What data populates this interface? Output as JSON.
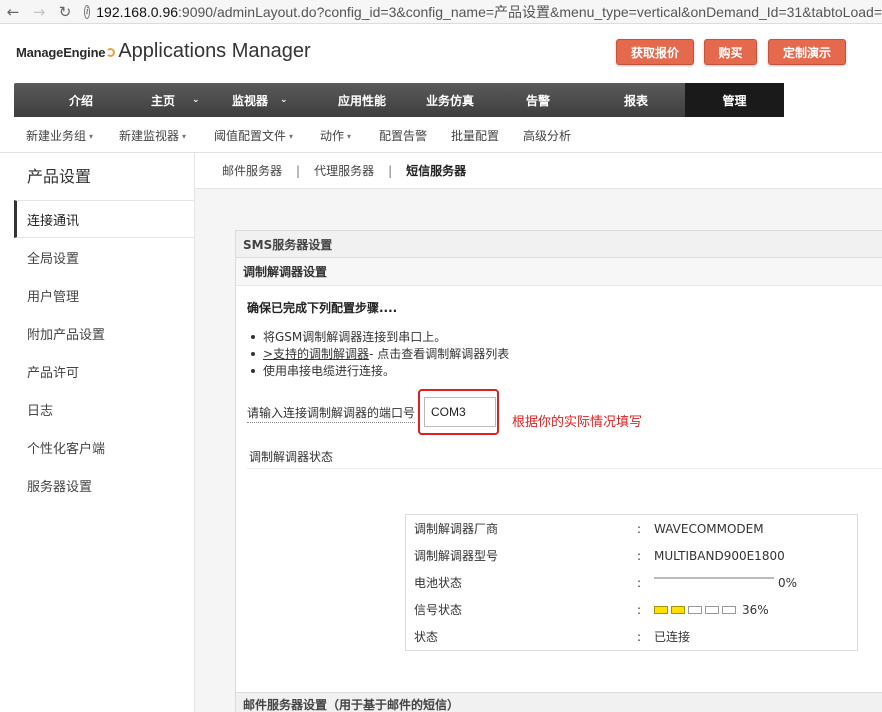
{
  "browser": {
    "back_icon": "arrow-left-icon",
    "forward_icon": "arrow-right-icon",
    "reload_icon": "reload-icon",
    "info_icon": "info-icon",
    "url_host": "192.168.0.96",
    "url_rest": ":9090/adminLayout.do?config_id=3&config_name=产品设置&menu_type=vertical&onDemand_Id=31&tabtoLoad="
  },
  "header": {
    "logo_brand": "ManageEngine",
    "logo_product": "Applications Manager",
    "buttons": [
      "获取报价",
      "购买",
      "定制演示"
    ],
    "accent_color": "#e5694c"
  },
  "mainnav": {
    "items": [
      {
        "label": "介绍",
        "chevron": false
      },
      {
        "label": "主页",
        "chevron": true
      },
      {
        "label": "监视器",
        "chevron": true
      },
      {
        "label": "应用性能",
        "chevron": false
      },
      {
        "label": "业务仿真",
        "chevron": false
      },
      {
        "label": "告警",
        "chevron": false
      },
      {
        "label": "报表",
        "chevron": false
      },
      {
        "label": "管理",
        "chevron": false,
        "active": true
      }
    ]
  },
  "subnav": {
    "items": [
      {
        "label": "新建业务组",
        "caret": true
      },
      {
        "label": "新建监视器",
        "caret": true
      },
      {
        "label": "阈值配置文件",
        "caret": true
      },
      {
        "label": "动作",
        "caret": true
      },
      {
        "label": "配置告警",
        "caret": false
      },
      {
        "label": "批量配置",
        "caret": false
      },
      {
        "label": "高级分析",
        "caret": false
      }
    ]
  },
  "sidebar": {
    "title": "产品设置",
    "items": [
      {
        "label": "连接通讯",
        "active": true
      },
      {
        "label": "全局设置"
      },
      {
        "label": "用户管理"
      },
      {
        "label": "附加产品设置"
      },
      {
        "label": "产品许可"
      },
      {
        "label": "日志"
      },
      {
        "label": "个性化客户端"
      },
      {
        "label": "服务器设置"
      }
    ]
  },
  "tabs": {
    "items": [
      "邮件服务器",
      "代理服务器",
      "短信服务器"
    ],
    "separator": "|",
    "active_index": 2
  },
  "sms": {
    "panel_title": "SMS服务器设置",
    "section_title": "调制解调器设置",
    "steps_title": "确保已完成下列配置步骤....",
    "steps": [
      {
        "text": "将GSM调制解调器连接到串口上。"
      },
      {
        "link": ">支持的调制解调器",
        "text": " - 点击查看调制解调器列表"
      },
      {
        "text": "使用串接电缆进行连接。"
      }
    ],
    "port_label": "请输入连接调制解调器的端口号",
    "port_value": "COM3",
    "annotation": "根据你的实际情况填写",
    "annotation_color": "#e02020",
    "status_title": "调制解调器状态",
    "status": {
      "vendor_label": "调制解调器厂商",
      "vendor_value": "WAVECOMMODEM",
      "model_label": "调制解调器型号",
      "model_value": "MULTIBAND900E1800",
      "battery_label": "电池状态",
      "battery_value": "0%",
      "battery_fraction": 0,
      "signal_label": "信号状态",
      "signal_value": "36%",
      "signal_bars_on": 2,
      "signal_bars_total": 5,
      "state_label": "状态",
      "state_value": "已连接",
      "colon": ":"
    }
  },
  "footer_panel_title": "邮件服务器设置（用于基于邮件的短信）"
}
